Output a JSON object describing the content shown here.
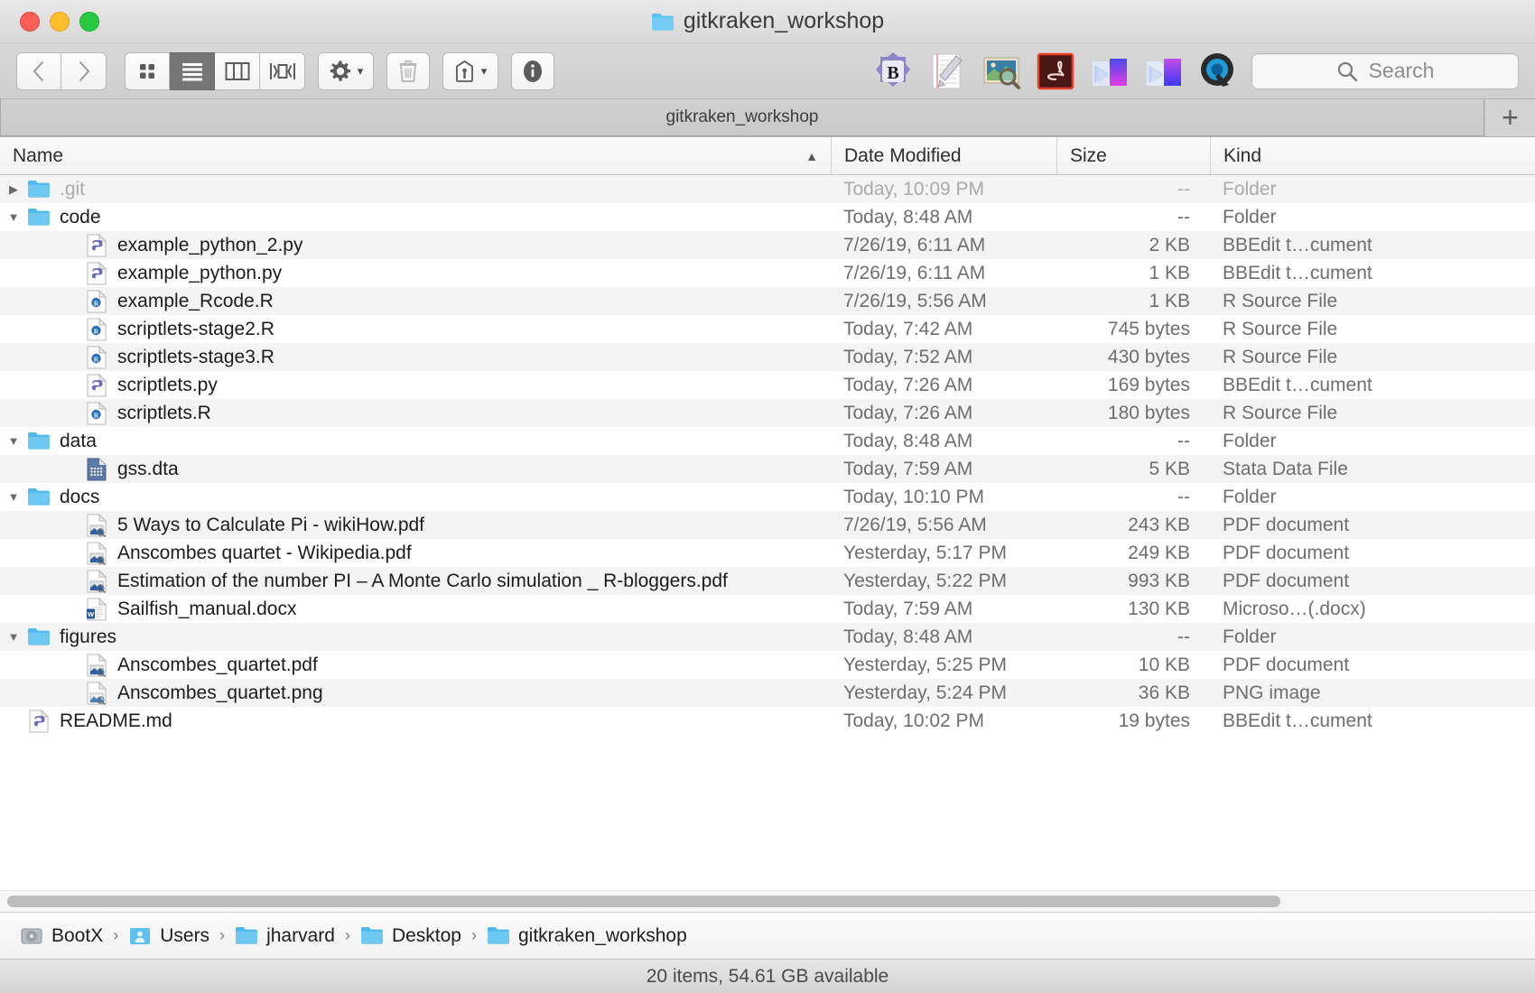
{
  "window": {
    "title": "gitkraken_workshop",
    "traffic_lights": [
      "close",
      "minimize",
      "maximize"
    ]
  },
  "toolbar": {
    "back_label": "‹",
    "forward_label": "›",
    "view_modes": [
      {
        "name": "icon-view",
        "selected": false
      },
      {
        "name": "list-view",
        "selected": true
      },
      {
        "name": "column-view",
        "selected": false
      },
      {
        "name": "gallery-view",
        "selected": false
      }
    ],
    "action_label": "gear",
    "delete_label": "trash",
    "share_label": "share",
    "info_label": "info",
    "app_icons": [
      "bbedit-app-icon",
      "textedit-app-icon",
      "preview-app-icon",
      "acrobat-app-icon",
      "finder-purple-app-icon",
      "finder-violet-app-icon",
      "quicktime-app-icon"
    ]
  },
  "search": {
    "placeholder": "Search"
  },
  "tabs": [
    {
      "label": "gitkraken_workshop",
      "active": true
    }
  ],
  "new_tab_label": "+",
  "columns": [
    {
      "key": "name",
      "label": "Name",
      "sorted": true,
      "sort_arrow": "▲"
    },
    {
      "key": "date",
      "label": "Date Modified"
    },
    {
      "key": "size",
      "label": "Size"
    },
    {
      "key": "kind",
      "label": "Kind"
    }
  ],
  "files": [
    {
      "name": ".git",
      "date": "Today, 10:09 PM",
      "size": "--",
      "kind": "Folder",
      "indent": 0,
      "icon": "folder",
      "disclosure": "collapsed",
      "dimmed": true
    },
    {
      "name": "code",
      "date": "Today, 8:48 AM",
      "size": "--",
      "kind": "Folder",
      "indent": 0,
      "icon": "folder",
      "disclosure": "expanded",
      "dimmed": false
    },
    {
      "name": "example_python_2.py",
      "date": "7/26/19, 6:11 AM",
      "size": "2 KB",
      "kind": "BBEdit t…cument",
      "indent": 1,
      "icon": "python",
      "disclosure": "none",
      "dimmed": false
    },
    {
      "name": "example_python.py",
      "date": "7/26/19, 6:11 AM",
      "size": "1 KB",
      "kind": "BBEdit t…cument",
      "indent": 1,
      "icon": "python",
      "disclosure": "none",
      "dimmed": false
    },
    {
      "name": "example_Rcode.R",
      "date": "7/26/19, 5:56 AM",
      "size": "1 KB",
      "kind": "R Source File",
      "indent": 1,
      "icon": "rfile",
      "disclosure": "none",
      "dimmed": false
    },
    {
      "name": "scriptlets-stage2.R",
      "date": "Today, 7:42 AM",
      "size": "745 bytes",
      "kind": "R Source File",
      "indent": 1,
      "icon": "rfile",
      "disclosure": "none",
      "dimmed": false
    },
    {
      "name": "scriptlets-stage3.R",
      "date": "Today, 7:52 AM",
      "size": "430 bytes",
      "kind": "R Source File",
      "indent": 1,
      "icon": "rfile",
      "disclosure": "none",
      "dimmed": false
    },
    {
      "name": "scriptlets.py",
      "date": "Today, 7:26 AM",
      "size": "169 bytes",
      "kind": "BBEdit t…cument",
      "indent": 1,
      "icon": "python",
      "disclosure": "none",
      "dimmed": false
    },
    {
      "name": "scriptlets.R",
      "date": "Today, 7:26 AM",
      "size": "180 bytes",
      "kind": "R Source File",
      "indent": 1,
      "icon": "rfile",
      "disclosure": "none",
      "dimmed": false
    },
    {
      "name": "data",
      "date": "Today, 8:48 AM",
      "size": "--",
      "kind": "Folder",
      "indent": 0,
      "icon": "folder",
      "disclosure": "expanded",
      "dimmed": false
    },
    {
      "name": "gss.dta",
      "date": "Today, 7:59 AM",
      "size": "5 KB",
      "kind": "Stata Data File",
      "indent": 1,
      "icon": "stata",
      "disclosure": "none",
      "dimmed": false
    },
    {
      "name": "docs",
      "date": "Today, 10:10 PM",
      "size": "--",
      "kind": "Folder",
      "indent": 0,
      "icon": "folder",
      "disclosure": "expanded",
      "dimmed": false
    },
    {
      "name": "5 Ways to Calculate Pi - wikiHow.pdf",
      "date": "7/26/19, 5:56 AM",
      "size": "243 KB",
      "kind": "PDF document",
      "indent": 1,
      "icon": "pdf",
      "disclosure": "none",
      "dimmed": false
    },
    {
      "name": "Anscombes quartet - Wikipedia.pdf",
      "date": "Yesterday, 5:17 PM",
      "size": "249 KB",
      "kind": "PDF document",
      "indent": 1,
      "icon": "pdf",
      "disclosure": "none",
      "dimmed": false
    },
    {
      "name": "Estimation of the number PI – A Monte Carlo simulation _ R-bloggers.pdf",
      "date": "Yesterday, 5:22 PM",
      "size": "993 KB",
      "kind": "PDF document",
      "indent": 1,
      "icon": "pdf",
      "disclosure": "none",
      "dimmed": false
    },
    {
      "name": "Sailfish_manual.docx",
      "date": "Today, 7:59 AM",
      "size": "130 KB",
      "kind": "Microso…(.docx)",
      "indent": 1,
      "icon": "docx",
      "disclosure": "none",
      "dimmed": false
    },
    {
      "name": "figures",
      "date": "Today, 8:48 AM",
      "size": "--",
      "kind": "Folder",
      "indent": 0,
      "icon": "folder",
      "disclosure": "expanded",
      "dimmed": false
    },
    {
      "name": "Anscombes_quartet.pdf",
      "date": "Yesterday, 5:25 PM",
      "size": "10 KB",
      "kind": "PDF document",
      "indent": 1,
      "icon": "pdf",
      "disclosure": "none",
      "dimmed": false
    },
    {
      "name": "Anscombes_quartet.png",
      "date": "Yesterday, 5:24 PM",
      "size": "36 KB",
      "kind": "PNG image",
      "indent": 1,
      "icon": "png",
      "disclosure": "none",
      "dimmed": false
    },
    {
      "name": "README.md",
      "date": "Today, 10:02 PM",
      "size": "19 bytes",
      "kind": "BBEdit t…cument",
      "indent": 0,
      "icon": "python",
      "disclosure": "none",
      "dimmed": false
    }
  ],
  "breadcrumb": [
    {
      "label": "BootX",
      "icon": "harddrive-icon"
    },
    {
      "label": "Users",
      "icon": "users-folder-icon"
    },
    {
      "label": "jharvard",
      "icon": "folder-icon"
    },
    {
      "label": "Desktop",
      "icon": "folder-icon"
    },
    {
      "label": "gitkraken_workshop",
      "icon": "folder-icon"
    }
  ],
  "breadcrumb_separator": "›",
  "status": {
    "text": "20 items, 54.61 GB available"
  },
  "colors": {
    "folder_blue": "#5ec2f0",
    "accent_selected": "#757575",
    "row_alt": "#f4f4f4",
    "text_primary": "#1c1c1c",
    "text_secondary": "#6e6e6e"
  }
}
